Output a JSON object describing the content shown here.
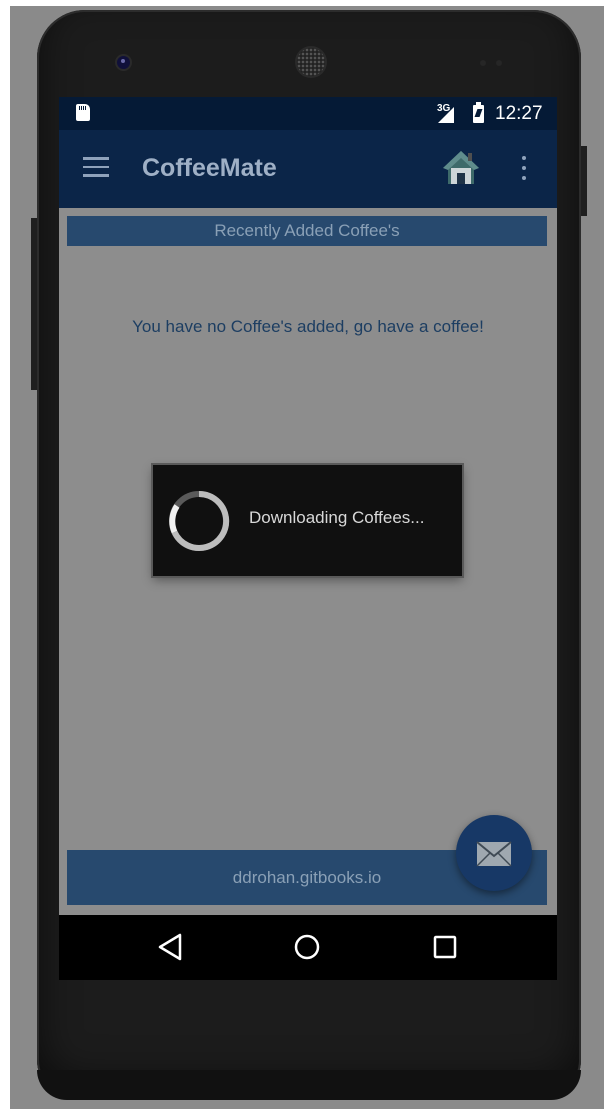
{
  "status_bar": {
    "network": "3G",
    "time": "12:27"
  },
  "app_bar": {
    "title": "CoffeeMate",
    "icons": [
      "menu-icon",
      "home-icon",
      "more-vert-icon"
    ]
  },
  "content": {
    "section_header": "Recently Added Coffee's",
    "empty_message": "You have no Coffee's added, go have a coffee!"
  },
  "progress_dialog": {
    "message": "Downloading Coffees..."
  },
  "footer": {
    "text": "ddrohan.gitbooks.io"
  },
  "fab": {
    "icon": "email-icon"
  },
  "nav_bar": {
    "icons": [
      "back-icon",
      "home-circle-icon",
      "recents-icon"
    ]
  },
  "colors": {
    "status_bar": "#051a36",
    "app_bar": "#0b2548",
    "section_bar": "#27496e",
    "fab": "#173866",
    "dim_background": "#8d8d8d"
  }
}
